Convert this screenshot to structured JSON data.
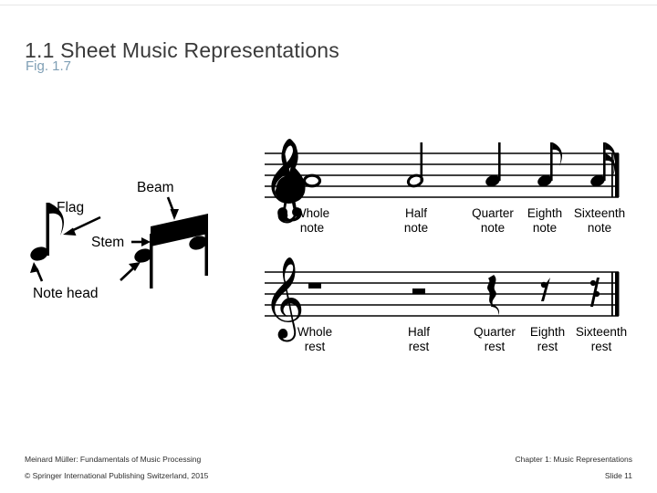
{
  "slide": {
    "title": "1.1 Sheet Music Representations",
    "subtitle": "Fig. 1.7",
    "footer": {
      "left_line1": "Meinard Müller: Fundamentals of Music Processing",
      "left_line2": "© Springer International  Publishing Switzerland, 2015",
      "right_line1": "Chapter 1: Music Representations",
      "right_line2": "Slide  11"
    }
  },
  "figure": {
    "left_diagram": {
      "labels": {
        "beam": "Beam",
        "flag": "Flag",
        "stem": "Stem",
        "note_head": "Note head"
      }
    },
    "notes_staff": {
      "clef": "treble-clef",
      "items": [
        {
          "line1": "Whole",
          "line2": "note"
        },
        {
          "line1": "Half",
          "line2": "note"
        },
        {
          "line1": "Quarter",
          "line2": "note"
        },
        {
          "line1": "Eighth",
          "line2": "note"
        },
        {
          "line1": "Sixteenth",
          "line2": "note"
        }
      ]
    },
    "rests_staff": {
      "clef": "treble-clef",
      "items": [
        {
          "line1": "Whole",
          "line2": "rest"
        },
        {
          "line1": "Half",
          "line2": "rest"
        },
        {
          "line1": "Quarter",
          "line2": "rest"
        },
        {
          "line1": "Eighth",
          "line2": "rest"
        },
        {
          "line1": "Sixteenth",
          "line2": "rest"
        }
      ]
    }
  },
  "colors": {
    "title": "#3a3a3a",
    "subtitle": "#7f9fb5",
    "ink": "#000000",
    "background": "#ffffff"
  }
}
